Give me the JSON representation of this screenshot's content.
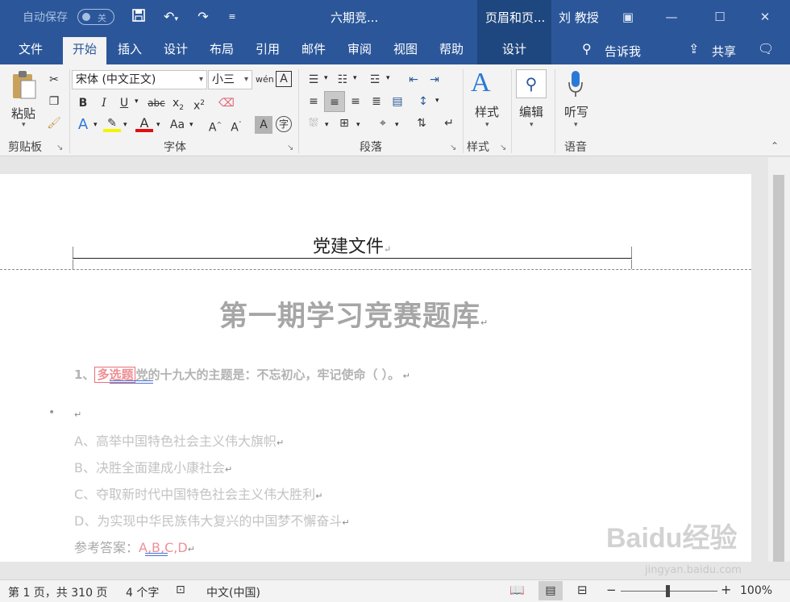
{
  "titlebar": {
    "autosave_label": "自动保存",
    "autosave_state": "关",
    "doc_title": "六期竞...",
    "context_tab_title": "页眉和页...",
    "user_name": "刘 教授"
  },
  "tabs": [
    "文件",
    "开始",
    "插入",
    "设计",
    "布局",
    "引用",
    "邮件",
    "审阅",
    "视图",
    "帮助",
    "设计"
  ],
  "tell_me": "告诉我",
  "share": "共享",
  "ribbon": {
    "clipboard": {
      "paste": "粘贴",
      "label": "剪贴板"
    },
    "font": {
      "name": "宋体 (中文正文)",
      "size": "小三",
      "label": "字体"
    },
    "paragraph": {
      "label": "段落"
    },
    "styles": {
      "button": "样式",
      "label": "样式"
    },
    "editing": {
      "button": "编辑"
    },
    "voice": {
      "button": "听写",
      "label": "语音"
    }
  },
  "document": {
    "header": "党建文件",
    "heading": "第一期学习竞赛题库",
    "question_number": "1、",
    "question_tag": "多选题",
    "question_text": "党的十九大的主题是：不忘初心，牢记使命（ ）。",
    "options": [
      "A、高举中国特色社会主义伟大旗帜",
      "B、决胜全面建成小康社会",
      "C、夺取新时代中国特色社会主义伟大胜利",
      "D、为实现中华民族伟大复兴的中国梦不懈奋斗"
    ],
    "answer_label": "参考答案：",
    "answer_value": "A,B,C,D"
  },
  "statusbar": {
    "page": "第 1 页，共 310 页",
    "words": "4 个字",
    "language": "中文(中国)",
    "zoom": "100%"
  },
  "watermark": {
    "brand": "Baidu经验",
    "url": "jingyan.baidu.com"
  }
}
